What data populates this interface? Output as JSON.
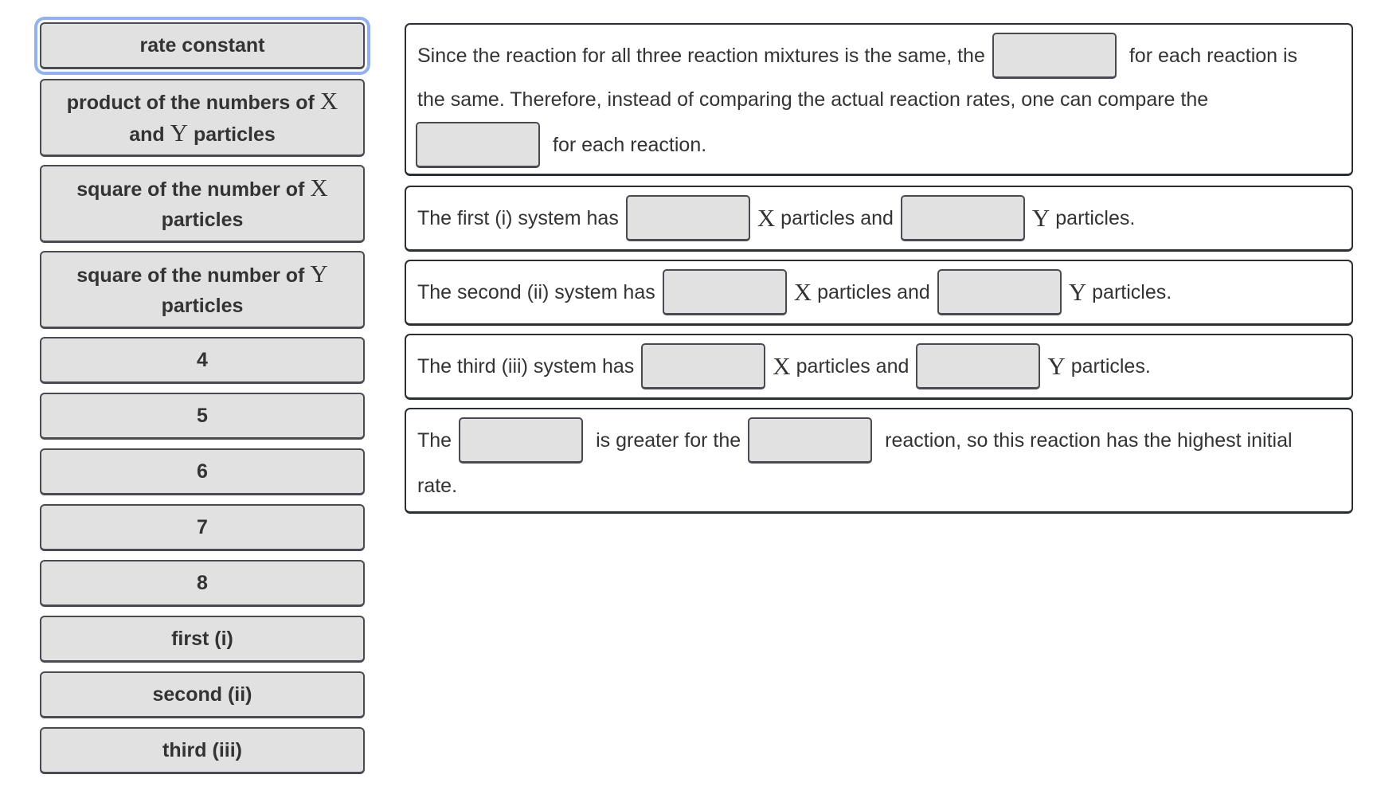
{
  "answer_bank": {
    "items": [
      {
        "text": "rate constant",
        "focused": true
      },
      {
        "pre": "product of the numbers of ",
        "var1": "X",
        "mid": "and ",
        "var2": "Y",
        "post": " particles"
      },
      {
        "pre": "square of the number of ",
        "var1": "X",
        "post": "particles"
      },
      {
        "pre": "square of the number of ",
        "var1": "Y",
        "post": "particles"
      },
      {
        "text": "4"
      },
      {
        "text": "5"
      },
      {
        "text": "6"
      },
      {
        "text": "7"
      },
      {
        "text": "8"
      },
      {
        "text": "first (i)"
      },
      {
        "text": "second (ii)"
      },
      {
        "text": "third (iii)"
      }
    ]
  },
  "panels": {
    "p1": {
      "l1a": "Since the reaction for all three reaction mixtures is the same, the",
      "l1b": "for each reaction is",
      "l2": "the same. Therefore, instead of comparing the actual reaction rates, one can compare the",
      "l3": "for each reaction."
    },
    "p2": {
      "a": "The first (i) system has",
      "x": "X",
      "b": "particles and",
      "y": "Y",
      "c": "particles."
    },
    "p3": {
      "a": "The second (ii) system has",
      "x": "X",
      "b": "particles and",
      "y": "Y",
      "c": "particles."
    },
    "p4": {
      "a": "The third (iii) system has",
      "x": "X",
      "b": "particles and",
      "y": "Y",
      "c": "particles."
    },
    "p5": {
      "a": "The",
      "b": "is greater for the",
      "c": "reaction, so this reaction has the highest initial",
      "d": "rate."
    }
  },
  "colors": {
    "tile_bg": "#e1e1e1",
    "focus_ring": "#93b0ef",
    "text": "#333333"
  }
}
